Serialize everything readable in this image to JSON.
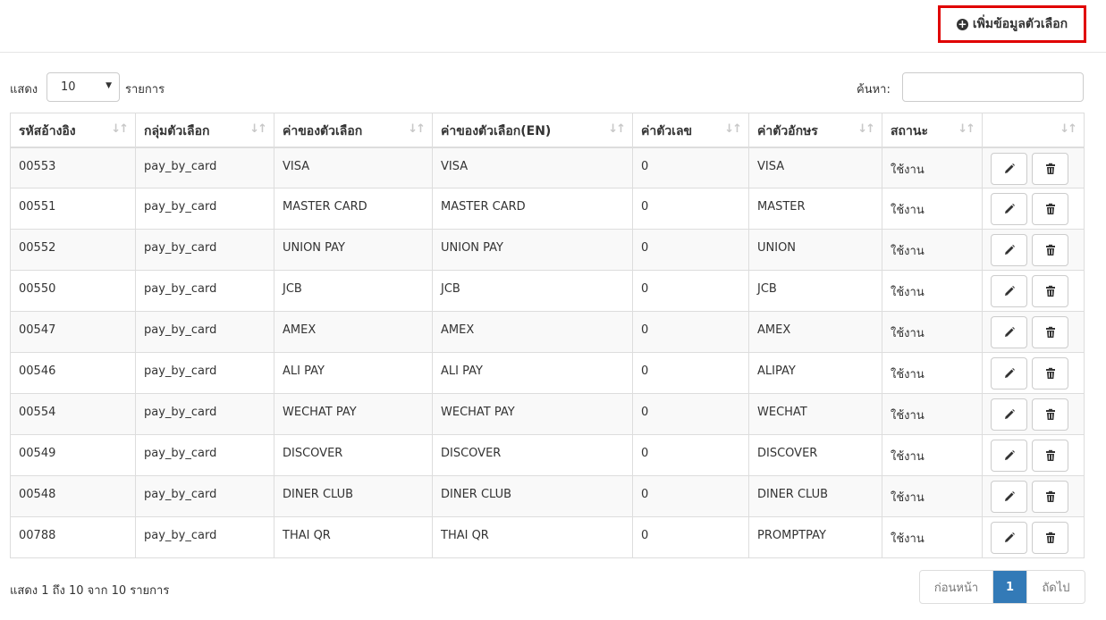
{
  "toolbar": {
    "add_label": "เพิ่มข้อมูลตัวเลือก",
    "add_icon": "plus-circle-icon"
  },
  "length": {
    "before": "แสดง",
    "value": "10",
    "after": "รายการ"
  },
  "search": {
    "label": "ค้นหา:",
    "value": ""
  },
  "columns": [
    "รหัสอ้างอิง",
    "กลุ่มตัวเลือก",
    "ค่าของตัวเลือก",
    "ค่าของตัวเลือก(EN)",
    "ค่าตัวเลข",
    "ค่าตัวอักษร",
    "สถานะ",
    ""
  ],
  "rows": [
    [
      "00553",
      "pay_by_card",
      "VISA",
      "VISA",
      "0",
      "VISA",
      "ใช้งาน"
    ],
    [
      "00551",
      "pay_by_card",
      "MASTER CARD",
      "MASTER CARD",
      "0",
      "MASTER",
      "ใช้งาน"
    ],
    [
      "00552",
      "pay_by_card",
      "UNION PAY",
      "UNION PAY",
      "0",
      "UNION",
      "ใช้งาน"
    ],
    [
      "00550",
      "pay_by_card",
      "JCB",
      "JCB",
      "0",
      "JCB",
      "ใช้งาน"
    ],
    [
      "00547",
      "pay_by_card",
      "AMEX",
      "AMEX",
      "0",
      "AMEX",
      "ใช้งาน"
    ],
    [
      "00546",
      "pay_by_card",
      "ALI PAY",
      "ALI PAY",
      "0",
      "ALIPAY",
      "ใช้งาน"
    ],
    [
      "00554",
      "pay_by_card",
      "WECHAT PAY",
      "WECHAT PAY",
      "0",
      "WECHAT",
      "ใช้งาน"
    ],
    [
      "00549",
      "pay_by_card",
      "DISCOVER",
      "DISCOVER",
      "0",
      "DISCOVER",
      "ใช้งาน"
    ],
    [
      "00548",
      "pay_by_card",
      "DINER CLUB",
      "DINER CLUB",
      "0",
      "DINER CLUB",
      "ใช้งาน"
    ],
    [
      "00788",
      "pay_by_card",
      "THAI QR",
      "THAI QR",
      "0",
      "PROMPTPAY",
      "ใช้งาน"
    ]
  ],
  "info": "แสดง 1 ถึง 10 จาก 10 รายการ",
  "pagination": {
    "prev": "ก่อนหน้า",
    "current": "1",
    "next": "ถัดไป"
  },
  "colors": {
    "highlight_border": "#e00000",
    "active_page": "#337ab7"
  }
}
